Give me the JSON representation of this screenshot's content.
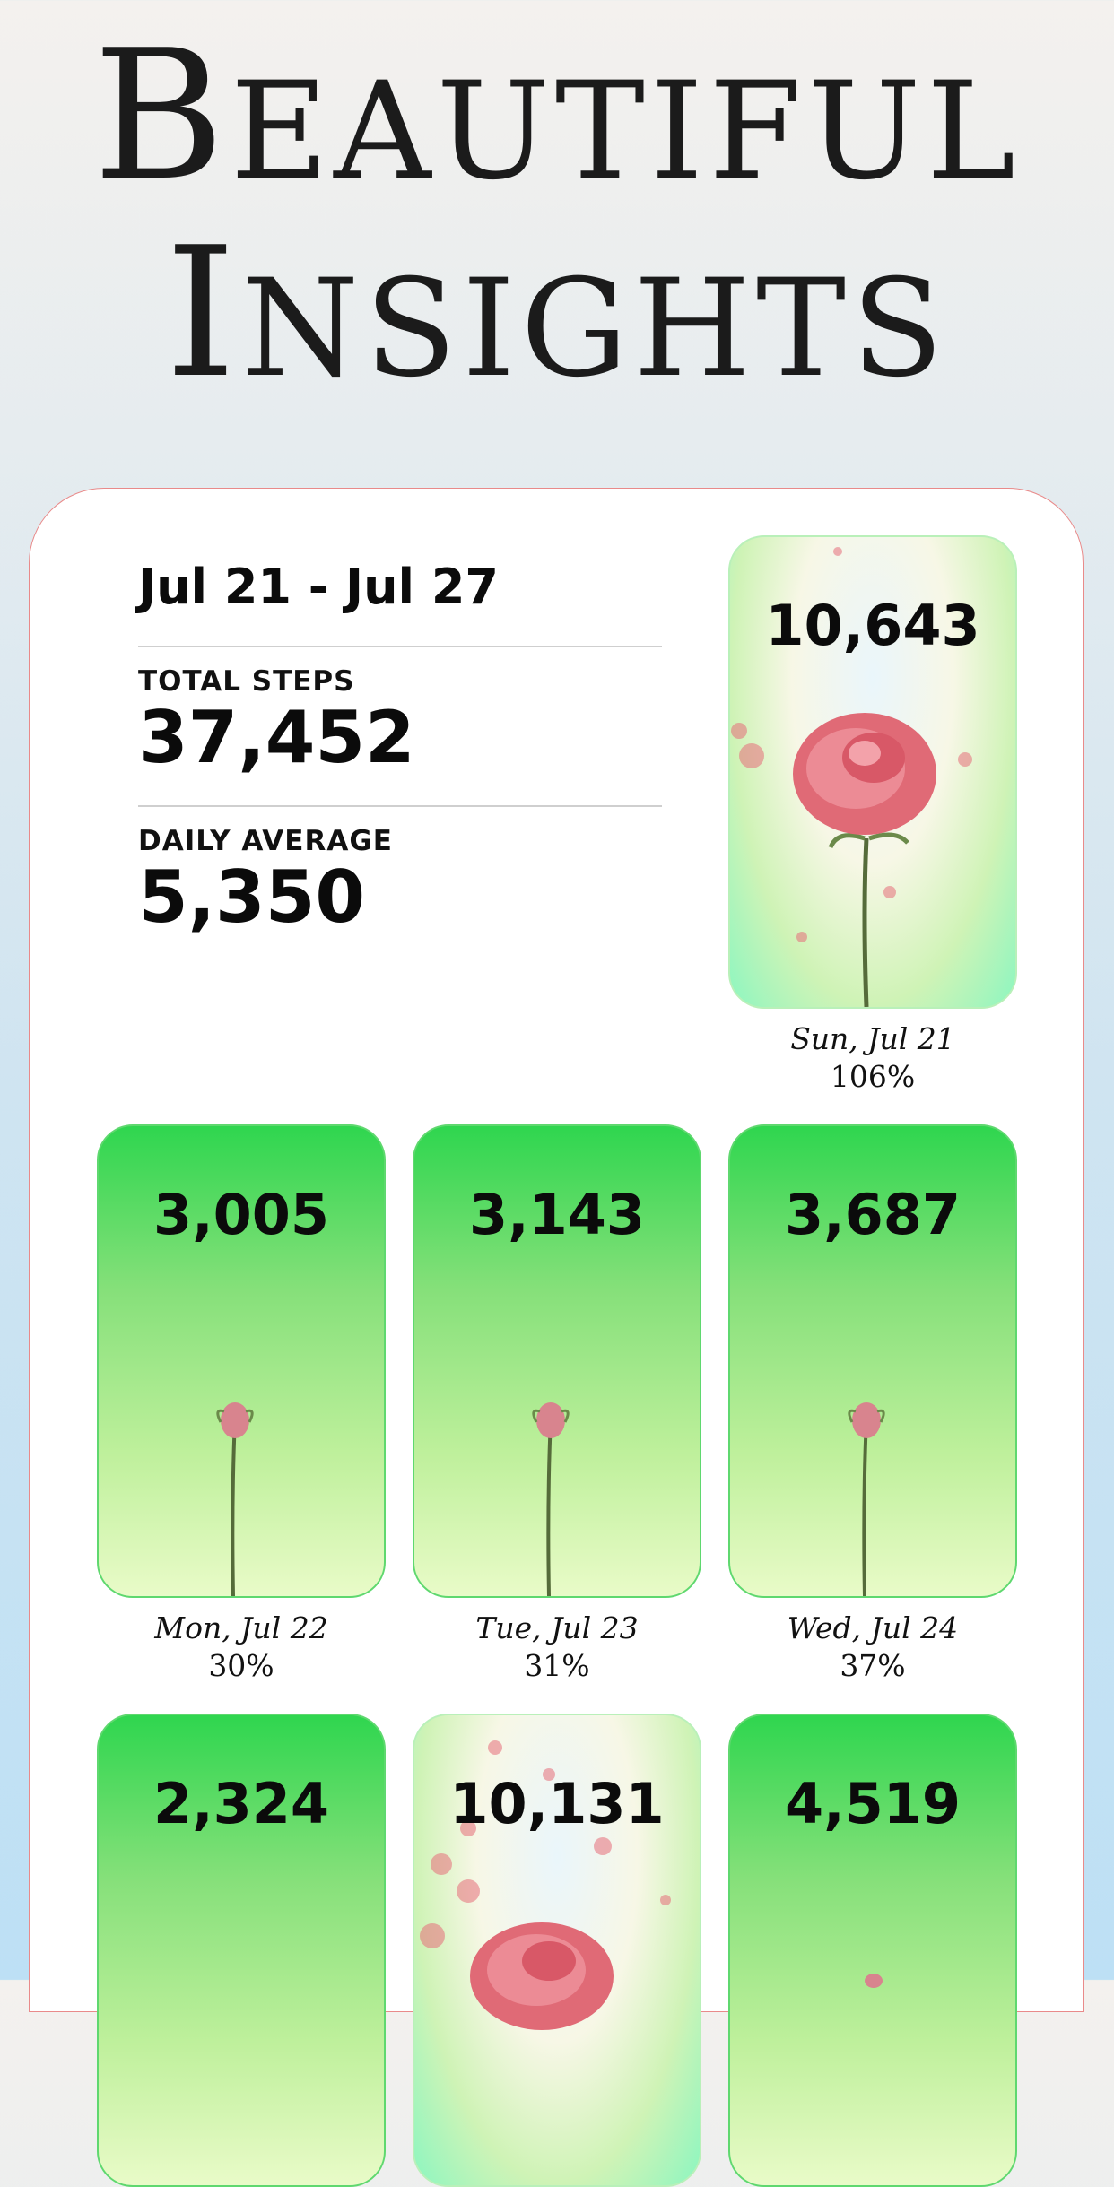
{
  "hero": {
    "line1_first": "B",
    "line1_rest": "EAUTIFUL",
    "line2_first": "I",
    "line2_rest": "NSIGHTS"
  },
  "summary": {
    "range": "Jul 21 - Jul 27",
    "total_label": "TOTAL STEPS",
    "total_value": "37,452",
    "avg_label": "DAILY AVERAGE",
    "avg_value": "5,350"
  },
  "days": [
    {
      "steps": "10,643",
      "day": "Sun, Jul 21",
      "pct": "106%",
      "style": "bloom"
    },
    {
      "steps": "3,005",
      "day": "Mon, Jul 22",
      "pct": "30%",
      "style": "bud"
    },
    {
      "steps": "3,143",
      "day": "Tue, Jul 23",
      "pct": "31%",
      "style": "bud"
    },
    {
      "steps": "3,687",
      "day": "Wed, Jul 24",
      "pct": "37%",
      "style": "bud"
    },
    {
      "steps": "2,324",
      "day": "",
      "pct": "",
      "style": "bud"
    },
    {
      "steps": "10,131",
      "day": "",
      "pct": "",
      "style": "bloom"
    },
    {
      "steps": "4,519",
      "day": "",
      "pct": "",
      "style": "bud"
    }
  ],
  "colors": {
    "accent": "#2fd64f",
    "rose": "#e56d7a",
    "card_border": "#e98a8a"
  }
}
